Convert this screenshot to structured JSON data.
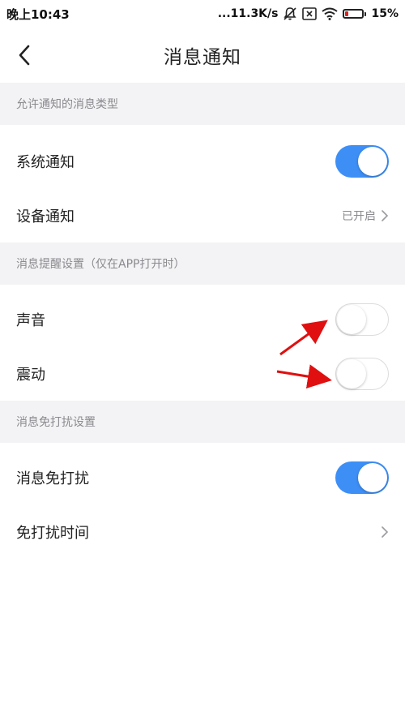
{
  "status_bar": {
    "time": "晚上10:43",
    "network_speed": "...11.3K/s",
    "battery_percent": "15%",
    "battery_level": 0.15,
    "icons": [
      "mute-bell-icon",
      "sim-x-icon",
      "wifi-icon",
      "battery-icon"
    ]
  },
  "nav": {
    "title": "消息通知",
    "back_icon": "chevron-left-icon"
  },
  "sections": {
    "allowed_types": {
      "header": "允许通知的消息类型",
      "rows": [
        {
          "label": "系统通知",
          "control": "toggle",
          "on": true
        },
        {
          "label": "设备通知",
          "value": "已开启",
          "control": "chevron"
        }
      ]
    },
    "reminder": {
      "header": "消息提醒设置（仅在APP打开时）",
      "rows": [
        {
          "label": "声音",
          "control": "toggle",
          "on": false
        },
        {
          "label": "震动",
          "control": "toggle",
          "on": false
        }
      ]
    },
    "dnd": {
      "header": "消息免打扰设置",
      "rows": [
        {
          "label": "消息免打扰",
          "control": "toggle",
          "on": true
        },
        {
          "label": "免打扰时间",
          "control": "chevron"
        }
      ]
    }
  },
  "colors": {
    "accent": "#3d8ff6",
    "section_bg": "#f3f3f5",
    "annotation_arrow": "#e01010"
  }
}
